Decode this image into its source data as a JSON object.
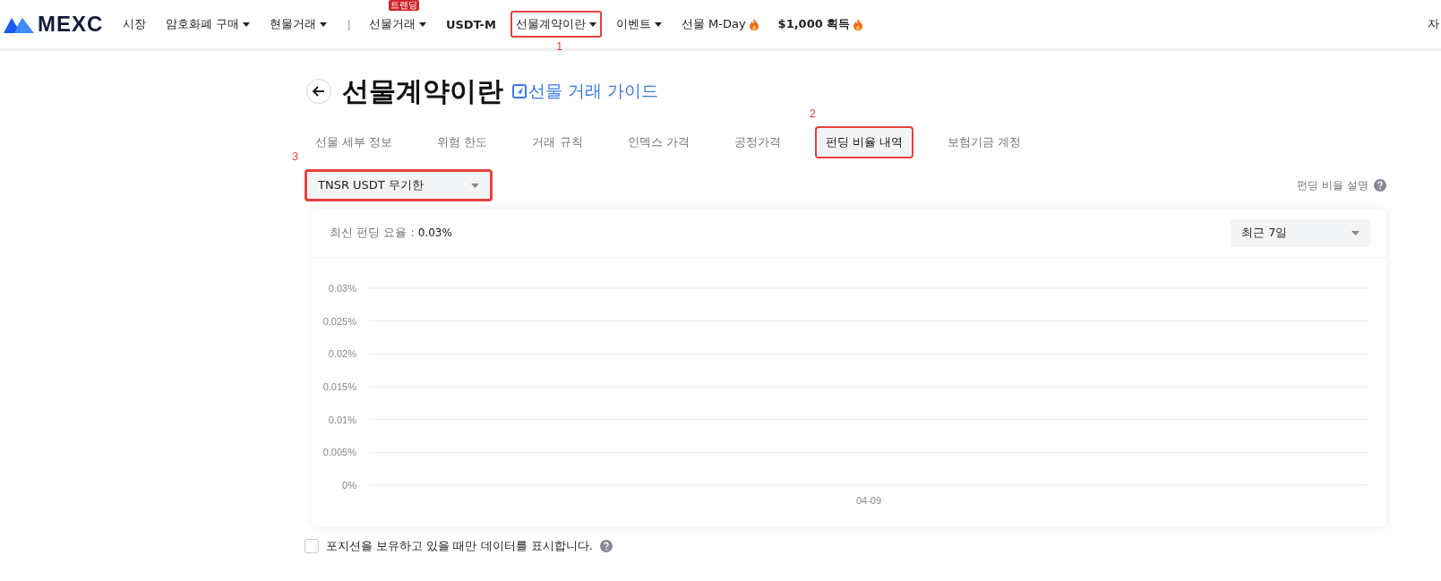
{
  "nav": {
    "logo": "MEXC",
    "items": [
      {
        "label": "시장",
        "caret": false,
        "bold": false,
        "fire": false
      },
      {
        "label": "암호화폐 구매",
        "caret": true,
        "bold": false,
        "fire": false
      },
      {
        "label": "현물거래",
        "caret": true,
        "bold": false,
        "fire": false
      },
      {
        "kind": "divider",
        "label": "|"
      },
      {
        "label": "선물거래",
        "caret": true,
        "bold": false,
        "fire": false,
        "badge": "트렌딩"
      },
      {
        "label": "USDT-M",
        "caret": false,
        "bold": true,
        "fire": false
      },
      {
        "label": "선물계약이란",
        "caret": true,
        "bold": false,
        "fire": false,
        "annotation": "1"
      },
      {
        "label": "이벤트",
        "caret": true,
        "bold": false,
        "fire": false
      },
      {
        "label": "선물 M-Day",
        "caret": false,
        "bold": false,
        "fire": true
      },
      {
        "label": "$1,000 획득",
        "caret": false,
        "fire": true,
        "bold": true
      }
    ],
    "right_text": "자"
  },
  "page": {
    "title": "선물계약이란",
    "guide_link": "선물 거래 가이드"
  },
  "tabs": [
    {
      "label": "선물 세부 정보",
      "selected": false
    },
    {
      "label": "위험 한도",
      "selected": false
    },
    {
      "label": "거래 규칙",
      "selected": false
    },
    {
      "label": "인덱스 가격",
      "selected": false
    },
    {
      "label": "공정가격",
      "selected": false
    },
    {
      "label": "펀딩 비율 내역",
      "selected": true,
      "annotation": "2"
    },
    {
      "label": "보험기금 계정",
      "selected": false
    }
  ],
  "contract_select": {
    "value": "TNSR USDT 무기한",
    "annotation": "3"
  },
  "help_link": "펀딩 비율 설명",
  "card": {
    "latest_label": "최신 펀딩 요율 :",
    "latest_value": "0.03%",
    "period_select": "최근 7일",
    "chart_data": {
      "type": "line",
      "grid": true,
      "categories": [
        "04-09"
      ],
      "ylim": [
        0,
        0.03
      ],
      "yticks": [
        {
          "value": 0,
          "label": "0%"
        },
        {
          "value": 0.005,
          "label": "0.005%"
        },
        {
          "value": 0.01,
          "label": "0.01%"
        },
        {
          "value": 0.015,
          "label": "0.015%"
        },
        {
          "value": 0.02,
          "label": "0.02%"
        },
        {
          "value": 0.025,
          "label": "0.025%"
        },
        {
          "value": 0.03,
          "label": "0.03%"
        }
      ]
    }
  },
  "position_filter": {
    "label": "포지션을 보유하고 있을 때만 데이터를 표시합니다.",
    "checked": false
  }
}
